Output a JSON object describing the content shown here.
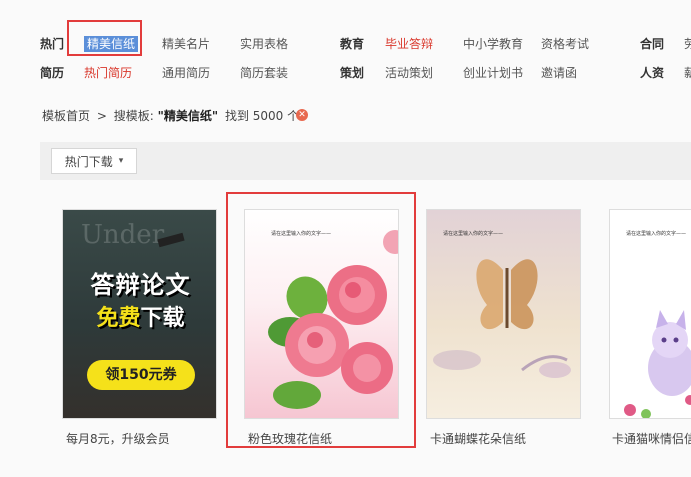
{
  "nav": {
    "row1": {
      "cat1": "热门",
      "cat1_links": [
        "精美信纸",
        "精美名片",
        "实用表格"
      ],
      "cat2": "教育",
      "cat2_links": [
        "毕业答辩",
        "中小学教育",
        "资格考试"
      ],
      "cat3": "合同",
      "cat3_cut": "劳"
    },
    "row2": {
      "cat1": "简历",
      "cat1_links": [
        "热门简历",
        "通用简历",
        "简历套装"
      ],
      "cat2": "策划",
      "cat2_links": [
        "活动策划",
        "创业计划书",
        "邀请函"
      ],
      "cat3": "人资",
      "cat3_cut": "薪"
    }
  },
  "breadcrumb": {
    "home": "模板首页",
    "sep": ">",
    "search_label": "搜模板:",
    "query": "\"精美信纸\"",
    "found": "找到 5000 个",
    "clear_icon": "close-circle-icon"
  },
  "filter": {
    "dropdown_label": "热门下载",
    "arrow": "▾"
  },
  "cards": [
    {
      "caption": "每月8元，升级会员",
      "promo_bg_text": "Under",
      "promo_line1": "答辩论文",
      "promo_line2_a": "免费",
      "promo_line2_b": "下载",
      "promo_button": "领150元券"
    },
    {
      "caption": "粉色玫瑰花信纸",
      "paper_header": "请在这里输入你的文字——"
    },
    {
      "caption": "卡通蝴蝶花朵信纸",
      "paper_header": "请在这里输入你的文字——"
    },
    {
      "caption": "卡通猫咪情侣信",
      "paper_header": "请在这里输入你的文字——"
    }
  ],
  "colors": {
    "highlight_red": "#e23c3c",
    "nav_red": "#d9372b",
    "selection_blue": "#5b8fd9",
    "promo_yellow": "#f5e11a",
    "promo_green": "#7be04a"
  }
}
